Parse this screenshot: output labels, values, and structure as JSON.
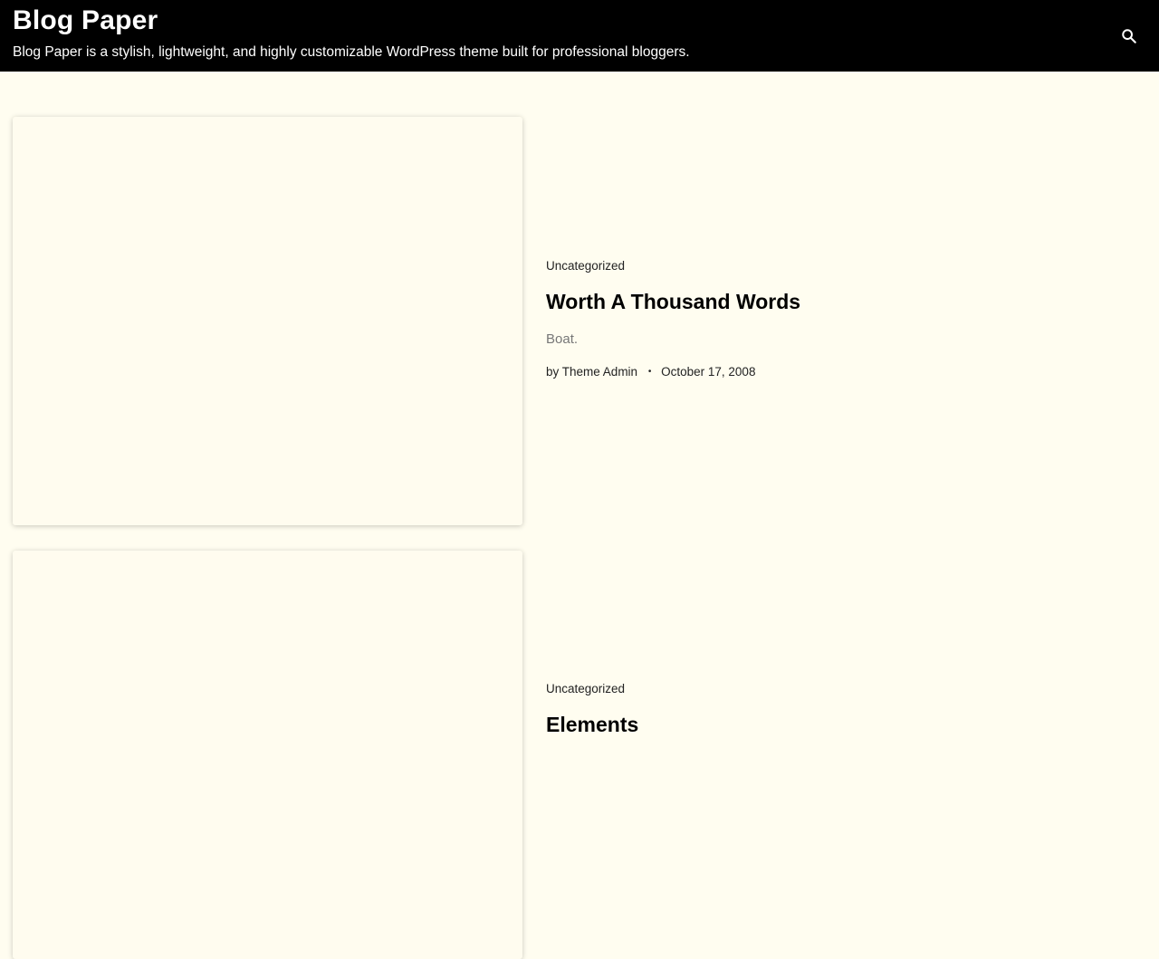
{
  "header": {
    "site_title": "Blog Paper",
    "tagline": "Blog Paper is a stylish, lightweight, and highly customizable WordPress theme built for professional bloggers.",
    "search_icon": "search-icon"
  },
  "posts": [
    {
      "category": "Uncategorized",
      "title": "Worth A Thousand Words",
      "excerpt": "Boat.",
      "author_prefix": "by",
      "author": "Theme Admin",
      "date": "October 17, 2008"
    },
    {
      "category": "Uncategorized",
      "title": "Elements"
    }
  ],
  "colors": {
    "header_bg": "#000000",
    "page_bg": "#fffdf0",
    "excerpt": "#777777"
  }
}
